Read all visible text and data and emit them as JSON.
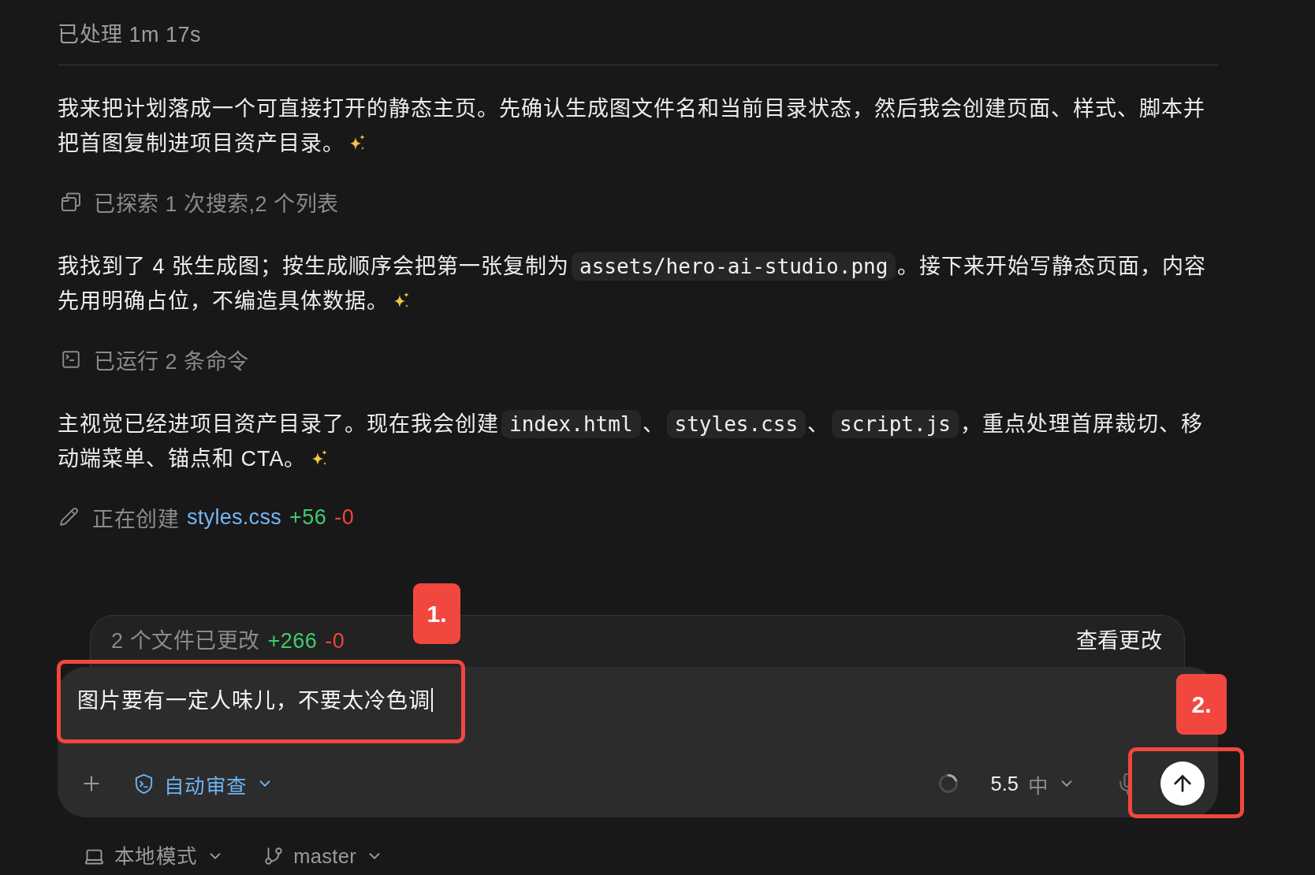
{
  "header": {
    "title": "已处理 1m 17s"
  },
  "transcript": [
    {
      "kind": "message",
      "segments": [
        {
          "kind": "text",
          "text": "我来把计划落成一个可直接打开的静态主页。先确认生成图文件名和当前目录状态，然后我会创建页面、样式、脚本并把首图复制进项目资产目录。"
        }
      ],
      "sparkle": true
    },
    {
      "kind": "explored",
      "text": "已探索 1 次搜索,2 个列表"
    },
    {
      "kind": "message",
      "segments": [
        {
          "kind": "text",
          "text": "我找到了 4 张生成图；按生成顺序会把第一张复制为"
        },
        {
          "kind": "code",
          "text": "assets/hero-ai-studio.png"
        },
        {
          "kind": "text",
          "text": "。接下来开始写静态页面，内容先用明确占位，不编造具体数据。"
        }
      ],
      "sparkle": true
    },
    {
      "kind": "commands",
      "text": "已运行 2 条命令"
    },
    {
      "kind": "message",
      "segments": [
        {
          "kind": "text",
          "text": "主视觉已经进项目资产目录了。现在我会创建"
        },
        {
          "kind": "code",
          "text": "index.html"
        },
        {
          "kind": "text",
          "text": "、"
        },
        {
          "kind": "code",
          "text": "styles.css"
        },
        {
          "kind": "text",
          "text": "、"
        },
        {
          "kind": "code",
          "text": "script.js"
        },
        {
          "kind": "text",
          "text": "，重点处理首屏裁切、移动端菜单、锚点和 CTA。"
        }
      ],
      "sparkle": true
    },
    {
      "kind": "editing",
      "action": "正在创建",
      "file": "styles.css",
      "added": "+56",
      "removed": "-0"
    }
  ],
  "changes_bar": {
    "summary": "2 个文件已更改",
    "added": "+266",
    "removed": "-0",
    "action": "查看更改"
  },
  "composer": {
    "value": "图片要有一定人味儿，不要太冷色调",
    "approval": "自动审查",
    "model": "5.5",
    "effort": "中"
  },
  "footer": {
    "mode": "本地模式",
    "branch": "master"
  },
  "annotations": [
    {
      "label": "1."
    },
    {
      "label": "2."
    }
  ]
}
